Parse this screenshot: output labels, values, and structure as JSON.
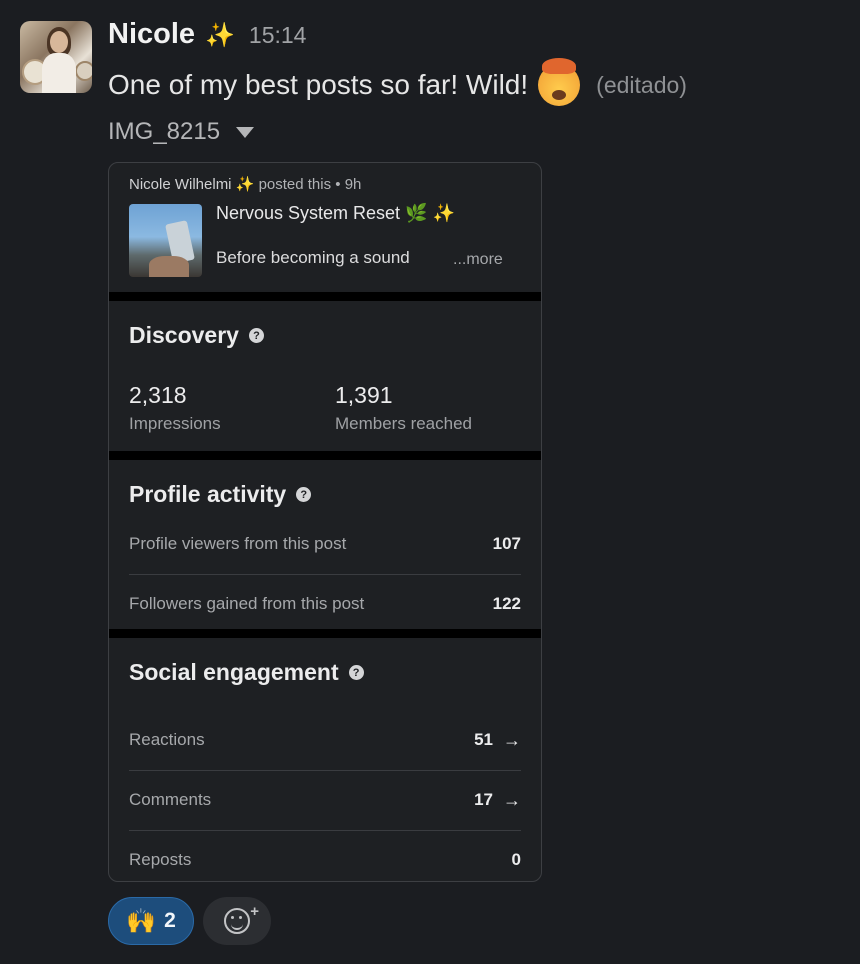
{
  "message": {
    "author": "Nicole",
    "author_badge": "✨",
    "time": "15:14",
    "text": "One of my best posts so far! Wild!",
    "emoji": "exploding-head",
    "edited_label": "(editado)",
    "attachment_name": "IMG_8215"
  },
  "card": {
    "post": {
      "author": "Nicole Wilhelmi",
      "author_badge": "✨",
      "action": "posted this • 9h",
      "title": "Nervous System Reset 🌿 ✨",
      "snippet": "Before becoming a sound",
      "more_label": "...more"
    },
    "discovery": {
      "title": "Discovery",
      "help": "?",
      "impressions_value": "2,318",
      "impressions_label": "Impressions",
      "members_value": "1,391",
      "members_label": "Members reached"
    },
    "profile_activity": {
      "title": "Profile activity",
      "help": "?",
      "rows": [
        {
          "label": "Profile viewers from this post",
          "value": "107"
        },
        {
          "label": "Followers gained from this post",
          "value": "122"
        }
      ]
    },
    "social_engagement": {
      "title": "Social engagement",
      "help": "?",
      "rows": [
        {
          "label": "Reactions",
          "value": "51",
          "arrow": "→"
        },
        {
          "label": "Comments",
          "value": "17",
          "arrow": "→"
        },
        {
          "label": "Reposts",
          "value": "0"
        }
      ]
    }
  },
  "reactions": [
    {
      "emoji": "🙌",
      "count": "2"
    }
  ],
  "add_reaction_plus": "+"
}
